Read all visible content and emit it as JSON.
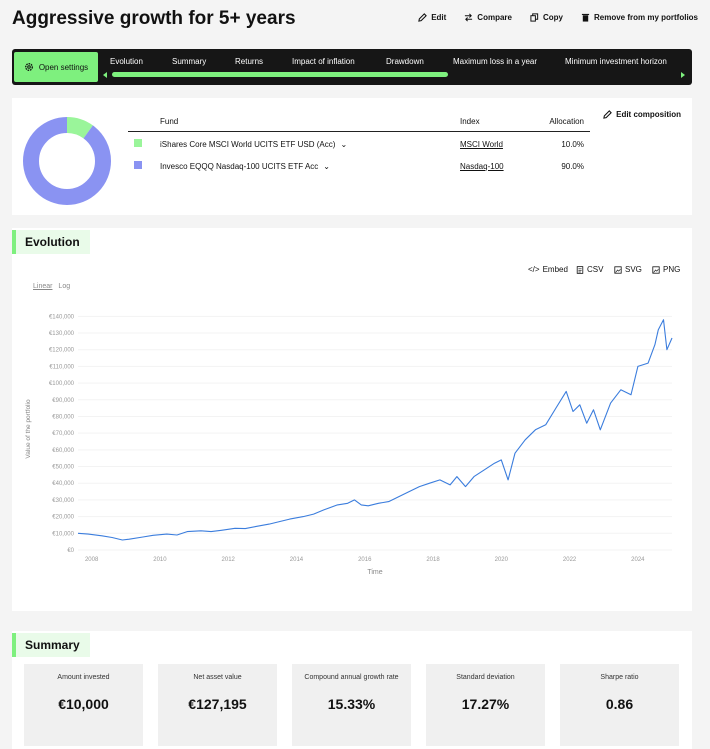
{
  "header": {
    "title": "Aggressive growth for 5+ years",
    "actions": {
      "edit": "Edit",
      "compare": "Compare",
      "copy": "Copy",
      "remove": "Remove from my portfolios"
    }
  },
  "nav": {
    "open_settings": "Open settings",
    "tabs": [
      "Evolution",
      "Summary",
      "Returns",
      "Impact of inflation",
      "Drawdown",
      "Maximum loss in a year",
      "Minimum investment horizon"
    ]
  },
  "composition": {
    "edit_label": "Edit composition",
    "headers": {
      "fund": "Fund",
      "index": "Index",
      "allocation": "Allocation"
    },
    "rows": [
      {
        "fund": "iShares Core MSCI World UCITS ETF USD (Acc)",
        "index": "MSCI World",
        "allocation": "10.0%",
        "color": "#9af59a"
      },
      {
        "fund": "Invesco EQQQ Nasdaq-100 UCITS ETF Acc",
        "index": "Nasdaq-100",
        "allocation": "90.0%",
        "color": "#8a93f2"
      }
    ],
    "donut_fractions": [
      0.1,
      0.9
    ]
  },
  "evolution": {
    "title": "Evolution",
    "exports": {
      "embed": "Embed",
      "csv": "CSV",
      "svg": "SVG",
      "png": "PNG"
    },
    "scale": {
      "linear": "Linear",
      "log": "Log"
    }
  },
  "chart_data": {
    "type": "line",
    "xlabel": "Time",
    "ylabel": "Value of the portfolio",
    "ylim": [
      0,
      145000
    ],
    "xlim": [
      2007.6,
      2025.0
    ],
    "y_ticks": [
      "€0",
      "€10,000",
      "€20,000",
      "€30,000",
      "€40,000",
      "€50,000",
      "€60,000",
      "€70,000",
      "€80,000",
      "€90,000",
      "€100,000",
      "€110,000",
      "€120,000",
      "€130,000",
      "€140,000"
    ],
    "x_ticks": [
      "2008",
      "2010",
      "2012",
      "2014",
      "2016",
      "2018",
      "2020",
      "2022",
      "2024"
    ],
    "series": [
      {
        "color": "#3b7ddd",
        "x": [
          2007.6,
          2007.9,
          2008.3,
          2008.6,
          2008.9,
          2009.1,
          2009.5,
          2009.8,
          2010.2,
          2010.5,
          2010.8,
          2011.2,
          2011.5,
          2011.8,
          2012.2,
          2012.5,
          2012.8,
          2013.2,
          2013.5,
          2013.8,
          2014.2,
          2014.5,
          2014.8,
          2015.2,
          2015.5,
          2015.7,
          2015.9,
          2016.1,
          2016.4,
          2016.7,
          2017.0,
          2017.3,
          2017.6,
          2017.9,
          2018.2,
          2018.5,
          2018.7,
          2018.95,
          2019.2,
          2019.5,
          2019.8,
          2020.0,
          2020.2,
          2020.4,
          2020.7,
          2021.0,
          2021.3,
          2021.6,
          2021.9,
          2022.1,
          2022.3,
          2022.5,
          2022.7,
          2022.9,
          2023.2,
          2023.5,
          2023.8,
          2024.0,
          2024.3,
          2024.5,
          2024.6,
          2024.75,
          2024.85,
          2025.0
        ],
        "y": [
          10000,
          9500,
          8500,
          7500,
          6000,
          6500,
          7800,
          8800,
          9500,
          9000,
          11000,
          11500,
          11000,
          11800,
          13000,
          12800,
          14000,
          15500,
          17000,
          18500,
          20000,
          21500,
          24000,
          27000,
          28000,
          30000,
          27000,
          26500,
          28000,
          29000,
          32000,
          35000,
          38000,
          40000,
          42000,
          39000,
          44000,
          38000,
          44000,
          48000,
          52000,
          54000,
          42000,
          58000,
          66000,
          72000,
          75000,
          85000,
          95000,
          83000,
          87000,
          76000,
          84000,
          72000,
          88000,
          96000,
          93000,
          110000,
          112000,
          123000,
          132000,
          138000,
          120000,
          127000
        ]
      }
    ]
  },
  "summary": {
    "title": "Summary",
    "metrics": [
      {
        "label": "Amount invested",
        "value": "€10,000"
      },
      {
        "label": "Net asset value",
        "value": "€127,195"
      },
      {
        "label": "Compound annual growth rate",
        "value": "15.33%"
      },
      {
        "label": "Standard deviation",
        "value": "17.27%"
      },
      {
        "label": "Sharpe ratio",
        "value": "0.86"
      }
    ]
  }
}
